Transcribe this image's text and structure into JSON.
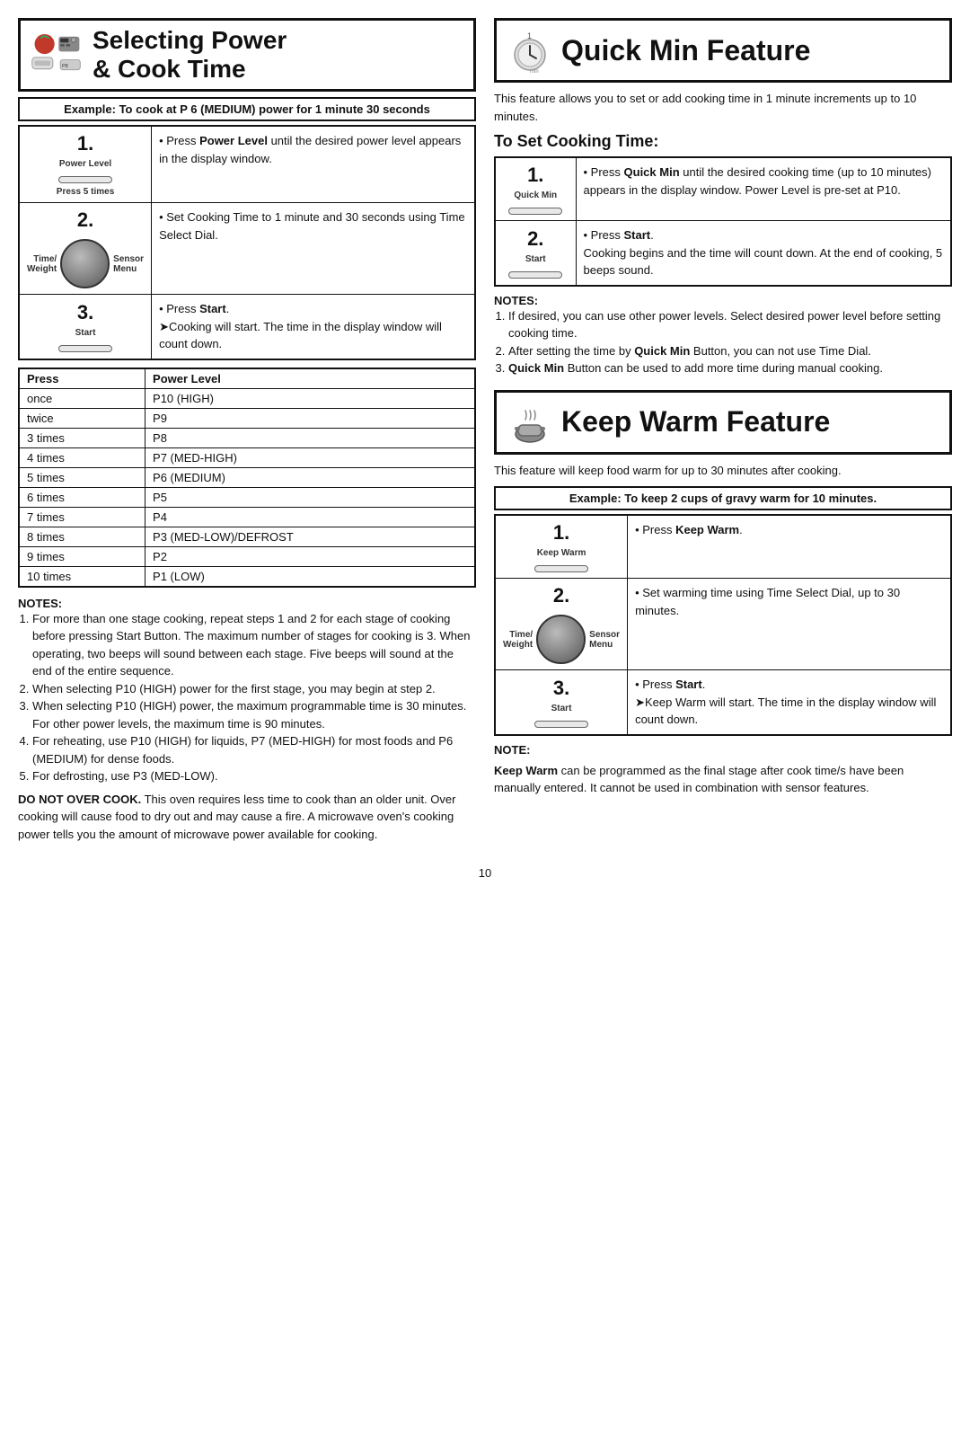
{
  "left": {
    "header": {
      "title_line1": "Selecting Power",
      "title_line2": "& Cook Time"
    },
    "example": {
      "text": "Example: To cook at P 6 (MEDIUM) power for 1 minute 30 seconds"
    },
    "steps": [
      {
        "num": "1.",
        "icon_label": "Power Level",
        "icon_type": "button",
        "sub_label": "Press 5 times",
        "content": "• Press Power Level until the desired power level appears in the display window."
      },
      {
        "num": "2.",
        "icon_label1": "Time/",
        "icon_label2": "Weight",
        "icon_label3": "Sensor",
        "icon_label4": "Menu",
        "icon_type": "dial",
        "content": "• Set Cooking Time to 1 minute and 30 seconds using Time Select Dial."
      },
      {
        "num": "3.",
        "icon_label": "Start",
        "icon_type": "button",
        "content": "• Press Start.\n➤Cooking will start. The time in the display window will count down."
      }
    ],
    "power_table": {
      "headers": [
        "Press",
        "Power Level"
      ],
      "rows": [
        [
          "once",
          "P10 (HIGH)"
        ],
        [
          "twice",
          "P9"
        ],
        [
          "3 times",
          "P8"
        ],
        [
          "4 times",
          "P7 (MED-HIGH)"
        ],
        [
          "5 times",
          "P6 (MEDIUM)"
        ],
        [
          "6 times",
          "P5"
        ],
        [
          "7 times",
          "P4"
        ],
        [
          "8 times",
          "P3 (MED-LOW)/DEFROST"
        ],
        [
          "9 times",
          "P2"
        ],
        [
          "10 times",
          "P1 (LOW)"
        ]
      ]
    },
    "notes_title": "NOTES:",
    "notes": [
      "For more than one stage cooking, repeat steps 1 and 2 for each stage of cooking before pressing Start Button. The maximum number of stages for cooking is 3. When operating, two beeps will sound between each stage. Five beeps will sound at the end of the entire sequence.",
      "When selecting P10 (HIGH) power for the first stage, you may begin at step 2.",
      "When selecting P10 (HIGH) power, the maximum programmable time is 30 minutes. For other power levels, the maximum time is 90 minutes.",
      "For reheating, use P10 (HIGH) for liquids, P7 (MED-HIGH) for most foods and P6 (MEDIUM) for dense foods.",
      "For defrosting, use P3 (MED-LOW)."
    ],
    "warning": "DO NOT OVER COOK. This oven requires less time to cook than an older unit. Over cooking will cause food to dry out and may cause a fire. A microwave oven's cooking power tells you the amount of microwave power available for cooking."
  },
  "right": {
    "quick_min": {
      "title": "Quick Min Feature",
      "intro": "This feature allows you to set or add cooking time in 1 minute increments up to 10 minutes.",
      "subsection_title": "To Set Cooking Time:",
      "steps": [
        {
          "num": "1.",
          "icon_label": "Quick Min",
          "icon_type": "button",
          "content": "• Press Quick Min until the desired cooking time (up to 10 minutes) appears in the display window. Power Level is pre-set at P10."
        },
        {
          "num": "2.",
          "icon_label": "Start",
          "icon_type": "button",
          "content": "• Press Start.\nCooking begins and the time will count down. At the end of cooking, 5 beeps sound."
        }
      ],
      "notes_title": "NOTES:",
      "notes": [
        "If desired, you can use other power levels. Select desired power level before setting cooking time.",
        "After setting the time by Quick Min Button, you can not use Time Dial.",
        "Quick Min Button can be used to add more time during manual cooking."
      ]
    },
    "keep_warm": {
      "title": "Keep Warm Feature",
      "intro": "This feature will keep food warm for up to 30 minutes after cooking.",
      "example": "Example: To keep 2 cups of gravy warm for 10 minutes.",
      "steps": [
        {
          "num": "1.",
          "icon_label": "Keep Warm",
          "icon_type": "button",
          "content": "• Press Keep Warm."
        },
        {
          "num": "2.",
          "icon_label1": "Time/",
          "icon_label2": "Weight",
          "icon_label3": "Sensor",
          "icon_label4": "Menu",
          "icon_type": "dial",
          "content": "• Set warming time using Time Select Dial, up to 30 minutes."
        },
        {
          "num": "3.",
          "icon_label": "Start",
          "icon_type": "button",
          "content": "• Press Start.\n➤Keep Warm will start. The time in the display window will count down."
        }
      ],
      "note_title": "NOTE:",
      "note": "Keep Warm can be programmed as the final stage after cook time/s have been manually entered. It cannot be used in combination with sensor features."
    }
  },
  "page_number": "10"
}
